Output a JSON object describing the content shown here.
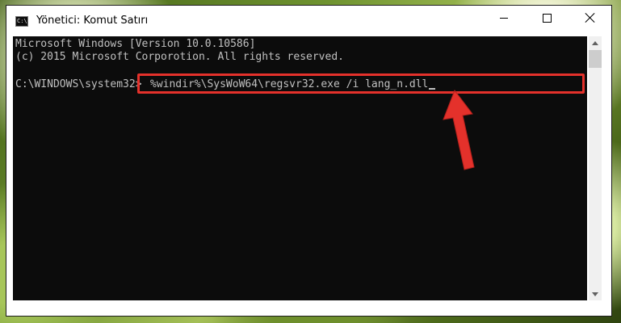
{
  "window": {
    "title": "Yönetici: Komut Satırı",
    "icon": "cmd-icon",
    "icon_text": "C:\\"
  },
  "console": {
    "lines": [
      "Microsoft Windows [Version 10.0.10586]",
      "(c) 2015 Microsoft Corporotion. All rights reserved."
    ],
    "prompt": "C:\\WINDOWS\\system32>",
    "command": "%windir%\\SysWoW64\\regsvr32.exe /i lang_n.dll"
  },
  "annotation": {
    "highlight_color": "#e4312b",
    "arrow_color": "#e4312b"
  }
}
